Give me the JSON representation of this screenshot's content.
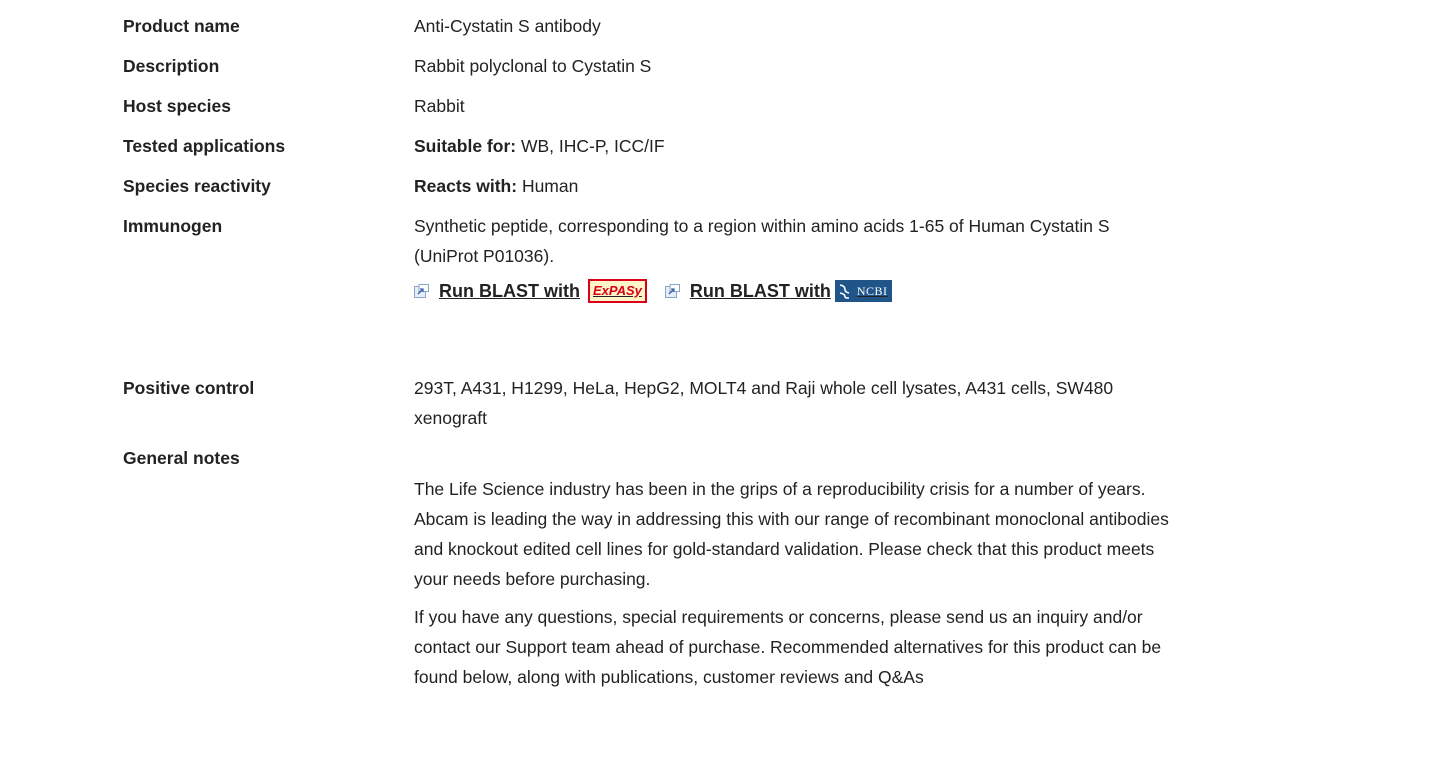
{
  "rows": {
    "product_name": {
      "label": "Product name",
      "value": "Anti-Cystatin S antibody"
    },
    "description": {
      "label": "Description",
      "value": "Rabbit polyclonal to Cystatin S"
    },
    "host_species": {
      "label": "Host species",
      "value": "Rabbit"
    },
    "tested_applications": {
      "label": "Tested applications",
      "prefix": "Suitable for:",
      "value": " WB, IHC-P, ICC/IF"
    },
    "species_reactivity": {
      "label": "Species reactivity",
      "prefix": "Reacts with:",
      "value": " Human"
    },
    "immunogen": {
      "label": "Immunogen",
      "line1": "Synthetic peptide, corresponding to a region within amino acids 1-65 of Human Cystatin S",
      "line2": "(UniProt P01036).",
      "blast_expasy": {
        "label": "Run BLAST with",
        "logo_text": "ExPASy"
      },
      "blast_ncbi": {
        "label": "Run BLAST with",
        "logo_text": "NCBI"
      }
    },
    "positive_control": {
      "label": "Positive control",
      "line1": "293T, A431, H1299, HeLa, HepG2, MOLT4 and Raji whole cell lysates, A431 cells, SW480",
      "line2": "xenograft"
    },
    "general_notes": {
      "label": "General notes",
      "para1": [
        "The Life Science industry has been in the grips of a reproducibility crisis for a number of years.",
        "Abcam is leading the way in addressing this with our range of recombinant monoclonal antibodies",
        "and knockout edited cell lines for gold-standard validation. Please check that this product meets",
        "your needs before purchasing."
      ],
      "para2": [
        "If you have any questions, special requirements or concerns, please send us an inquiry and/or",
        "contact our Support team ahead of purchase. Recommended alternatives for this product can be",
        "found below, along with publications, customer reviews and Q&As"
      ]
    }
  },
  "colors": {
    "text": "#222222",
    "expasy_red": "#d8001a",
    "ncbi_blue": "#20558a"
  }
}
